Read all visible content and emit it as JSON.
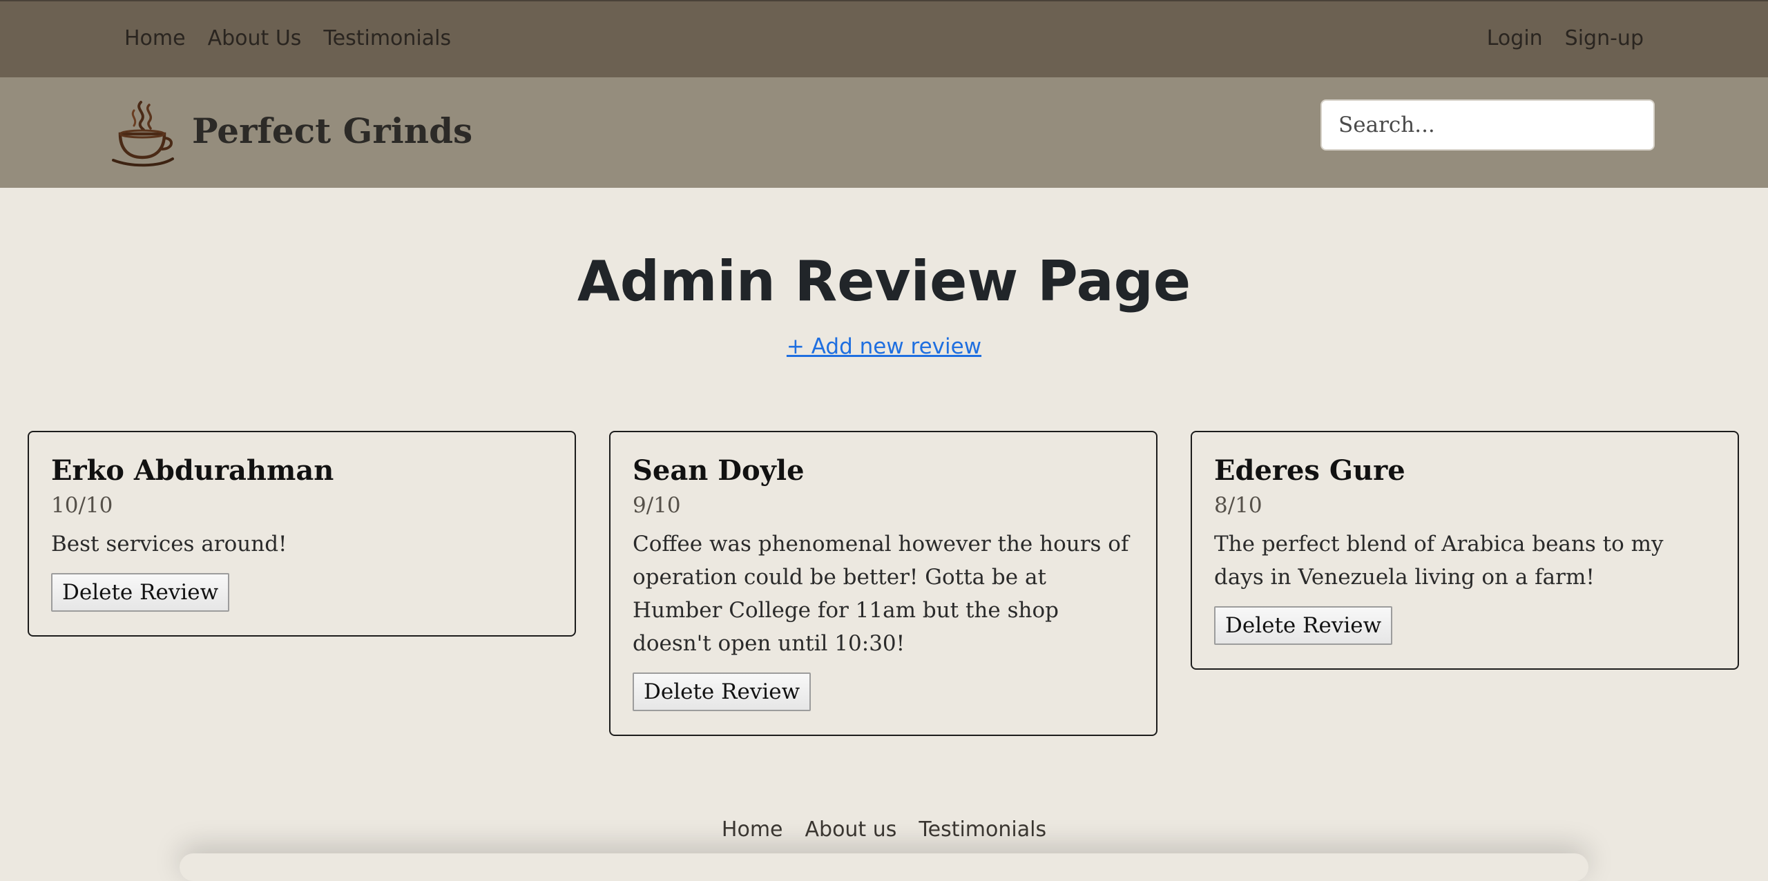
{
  "top_nav": {
    "left_links": [
      "Home",
      "About Us",
      "Testimonials"
    ],
    "right_links": [
      "Login",
      "Sign-up"
    ]
  },
  "brand": {
    "name": "Perfect Grinds",
    "logo_icon": "coffee-cup-icon"
  },
  "search": {
    "placeholder": "Search..."
  },
  "main": {
    "title": "Admin Review Page",
    "add_link": "+ Add new review"
  },
  "reviews": [
    {
      "name": "Erko Abdurahman",
      "rating": "10/10",
      "text": "Best services around!",
      "delete_label": "Delete Review"
    },
    {
      "name": "Sean Doyle",
      "rating": "9/10",
      "text": "Coffee was phenomenal however the hours of operation could be better! Gotta be at Humber College for 11am but the shop doesn't open until 10:30!",
      "delete_label": "Delete Review"
    },
    {
      "name": "Ederes Gure",
      "rating": "8/10",
      "text": "The perfect blend of Arabica beans to my days in Venezuela living on a farm!",
      "delete_label": "Delete Review"
    }
  ],
  "footer": {
    "links": [
      "Home",
      "About us",
      "Testimonials"
    ]
  },
  "colors": {
    "top_nav_bg": "#6c6152",
    "brand_bar_bg": "#958d7d",
    "page_bg": "#ece8e0",
    "link_blue": "#1f6fe0"
  }
}
